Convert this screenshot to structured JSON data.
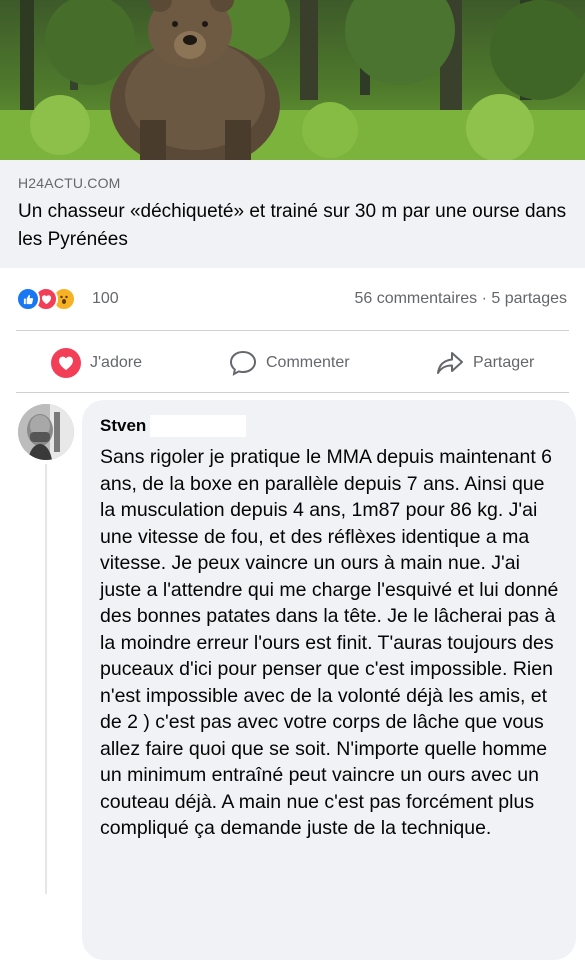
{
  "post": {
    "link": {
      "domain": "H24ACTU.COM",
      "headline": "Un chasseur «déchiqueté» et trainé sur 30 m par une ourse dans les Pyrénées"
    },
    "reactions": {
      "count": "100",
      "icons": [
        "like-icon",
        "love-icon",
        "wow-icon"
      ],
      "comments_shares": "56 commentaires · 5 partages"
    },
    "actions": {
      "like": "J'adore",
      "comment": "Commenter",
      "share": "Partager"
    }
  },
  "comment": {
    "author": "Stven",
    "text": "Sans rigoler je pratique le MMA depuis maintenant 6 ans, de la boxe en parallèle depuis 7 ans. Ainsi que la musculation depuis 4 ans, 1m87 pour 86 kg. J'ai une vitesse de fou, et des réflèxes identique a ma vitesse. Je peux vaincre un ours à main nue. J'ai juste a l'attendre qui me charge l'esquivé et lui donné des bonnes patates dans la tête. Je le lâcherai pas à la moindre erreur l'ours est finit. T'auras toujours des puceaux d'ici pour penser que c'est impossible. Rien n'est impossible avec de la volonté déjà les amis, et de 2 ) c'est pas avec votre corps de lâche que vous allez faire quoi que se soit. N'importe quelle homme un minimum entraîné peut vaincre un ours avec un couteau déjà. A main nue c'est pas forcément plus compliqué ça demande juste de la technique."
  },
  "colors": {
    "brand_blue": "#1877f2",
    "love_red": "#f33e58",
    "secondary_text": "#65676b",
    "bubble_bg": "#f0f2f5"
  }
}
